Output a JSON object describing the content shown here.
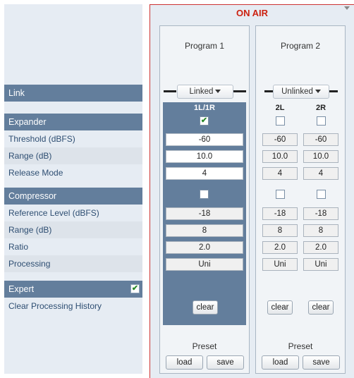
{
  "left_panel": {
    "link": "Link",
    "expander": {
      "heading": "Expander",
      "rows": [
        "Threshold (dBFS)",
        "Range (dB)",
        "Release Mode"
      ]
    },
    "compressor": {
      "heading": "Compressor",
      "rows": [
        "Reference Level (dBFS)",
        "Range (dB)",
        "Ratio",
        "Processing"
      ]
    },
    "expert": {
      "label": "Expert",
      "checked": true,
      "mark": "✔"
    },
    "clear_history": "Clear Processing History"
  },
  "on_air": {
    "title": "ON AIR",
    "program1": {
      "title": "Program 1",
      "link": "Linked",
      "channel": "1L/1R",
      "expander_on": "✔",
      "threshold": "-60",
      "range": "10.0",
      "release_mode": "4",
      "comp_ref": "-18",
      "comp_range": "8",
      "ratio": "2.0",
      "processing": "Uni",
      "clear": "clear",
      "preset": "Preset",
      "load": "load",
      "save": "save"
    },
    "program2": {
      "title": "Program 2",
      "link": "Unlinked",
      "channels": [
        "2L",
        "2R"
      ],
      "threshold": [
        "-60",
        "-60"
      ],
      "range": [
        "10.0",
        "10.0"
      ],
      "release_mode": [
        "4",
        "4"
      ],
      "comp_ref": [
        "-18",
        "-18"
      ],
      "comp_range": [
        "8",
        "8"
      ],
      "ratio": [
        "2.0",
        "2.0"
      ],
      "processing": [
        "Uni",
        "Uni"
      ],
      "clear": "clear",
      "preset": "Preset",
      "load": "load",
      "save": "save"
    }
  },
  "colors": {
    "header_blue": "#637e9c",
    "panel_bg": "#e6ecf3",
    "on_air_red": "#c21"
  }
}
